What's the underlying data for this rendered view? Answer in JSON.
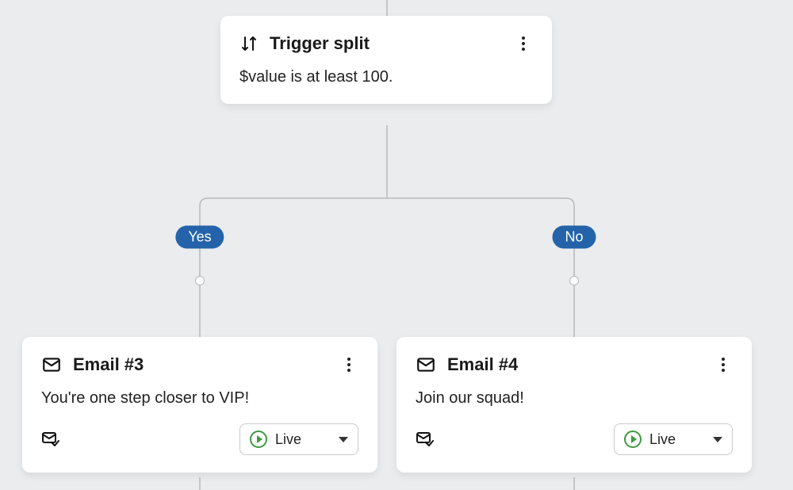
{
  "trigger": {
    "title": "Trigger split",
    "condition": "$value is at least 100."
  },
  "branches": {
    "yes_label": "Yes",
    "no_label": "No"
  },
  "emails": {
    "left": {
      "title": "Email #3",
      "subject": "You're one step closer to VIP!",
      "status": "Live"
    },
    "right": {
      "title": "Email #4",
      "subject": "Join our squad!",
      "status": "Live"
    }
  }
}
